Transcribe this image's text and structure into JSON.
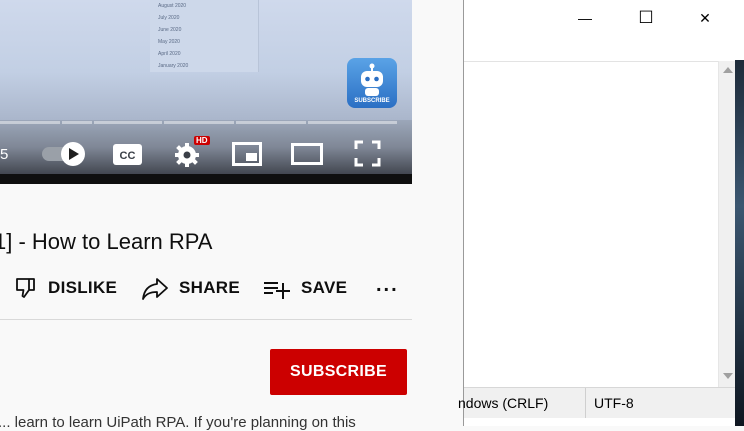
{
  "video": {
    "menu_items": [
      "August 2020",
      "July 2020",
      "June 2020",
      "May 2020",
      "April 2020",
      "January 2020"
    ],
    "time_fragment": "5",
    "hd_badge": "HD",
    "subscribe_badge_text": "SUBSCRIBE"
  },
  "page": {
    "title": "1] - How to Learn RPA",
    "actions": {
      "dislike": "DISLIKE",
      "share": "SHARE",
      "save": "SAVE",
      "more": "..."
    },
    "subscribe_label": "SUBSCRIBE",
    "description_fragment": "... learn to learn UiPath RPA. If you're planning on this"
  },
  "notepad": {
    "status": {
      "line_ending": "ndows (CRLF)",
      "encoding": "UTF-8"
    },
    "window_buttons": {
      "minimize": "—",
      "maximize": "☐",
      "close": "✕"
    }
  },
  "colors": {
    "subscribe_red": "#cc0000",
    "hd_red": "#cc0000"
  }
}
